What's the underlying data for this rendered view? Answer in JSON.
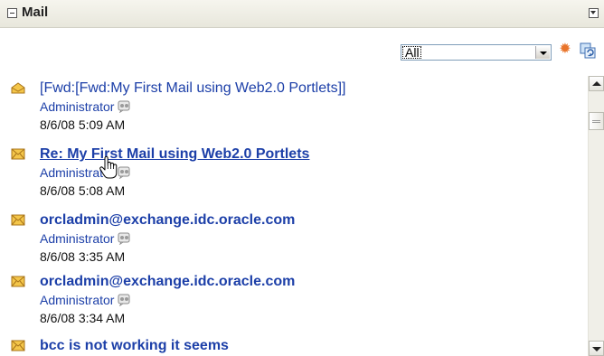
{
  "portlet": {
    "title": "Mail"
  },
  "toolbar": {
    "filter_value": "All",
    "new_icon": "new-item-icon",
    "refresh_icon": "refresh-icon"
  },
  "colors": {
    "link": "#1c3fa8",
    "header_bg": "#e8e7dc",
    "envelope": "#e0a21d"
  },
  "mails": [
    {
      "subject": "[Fwd:[Fwd:My First Mail using Web2.0 Portlets]]",
      "sender": "Administrator",
      "date": "8/6/08 5:09 AM",
      "state": "read"
    },
    {
      "subject": "Re: My First Mail using Web2.0 Portlets",
      "sender": "Administrator",
      "date": "8/6/08 5:08 AM",
      "state": "unread-hover"
    },
    {
      "subject": "orcladmin@exchange.idc.oracle.com",
      "sender": "Administrator",
      "date": "8/6/08 3:35 AM",
      "state": "unread"
    },
    {
      "subject": "orcladmin@exchange.idc.oracle.com",
      "sender": "Administrator",
      "date": "8/6/08 3:34 AM",
      "state": "unread"
    },
    {
      "subject": "bcc is not working it seems",
      "state": "unread"
    }
  ]
}
